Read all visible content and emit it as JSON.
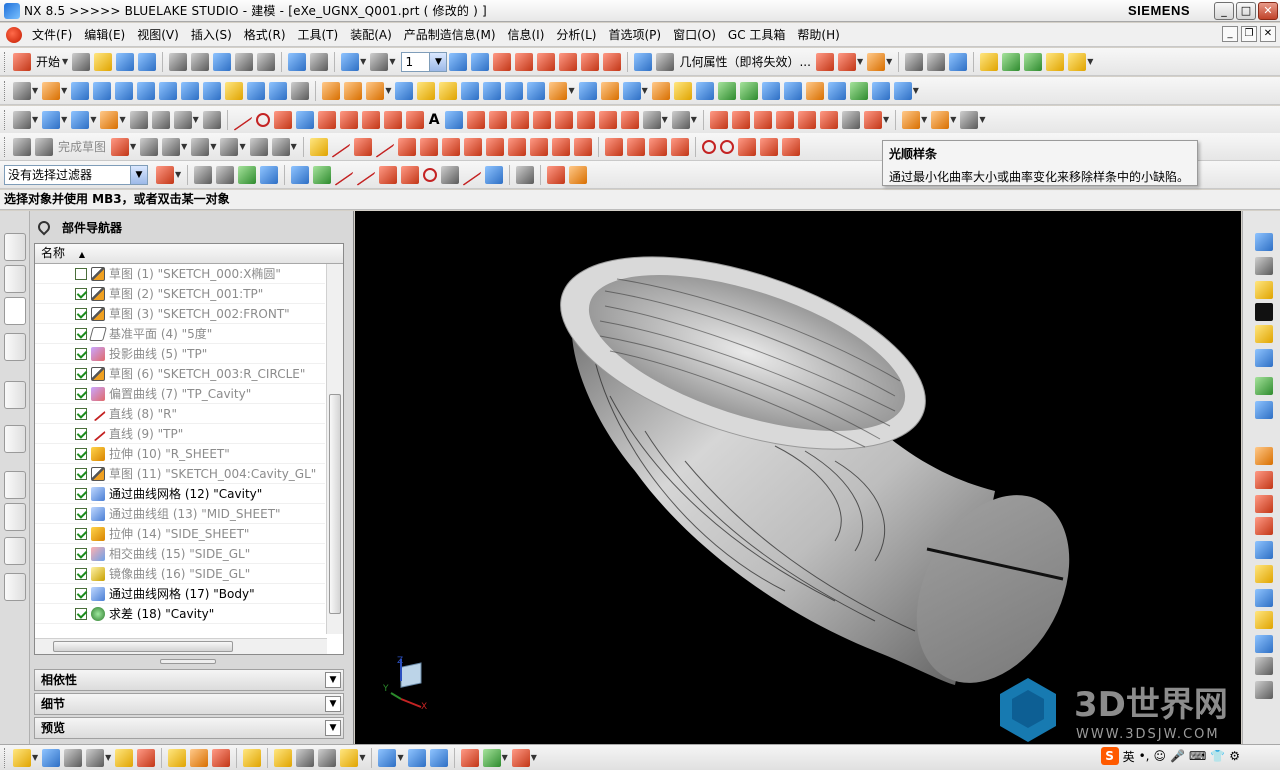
{
  "window": {
    "title": "NX 8.5  >>>>>  BLUELAKE STUDIO - 建模 - [eXe_UGNX_Q001.prt  ( 修改的 ) ]",
    "brand": "SIEMENS",
    "controls": {
      "minimize": "_",
      "maximize": "□",
      "close": "✕"
    }
  },
  "menubar": {
    "items": [
      "文件(F)",
      "编辑(E)",
      "视图(V)",
      "插入(S)",
      "格式(R)",
      "工具(T)",
      "装配(A)",
      "产品制造信息(M)",
      "信息(I)",
      "分析(L)",
      "首选项(P)",
      "窗口(O)",
      "GC 工具箱",
      "帮助(H)"
    ],
    "mdi": {
      "minimize": "_",
      "restore": "❐",
      "close": "✕"
    }
  },
  "toolbar": {
    "start_label": "开始",
    "layer_value": "1",
    "geometry_props_label": "几何属性（即将失效）...",
    "finish_sketch_label": "完成草图",
    "filter_value": "没有选择过滤器"
  },
  "prompt": {
    "text": "选择对象并使用 MB3，或者双击某一对象"
  },
  "tooltip": {
    "title": "光顺样条",
    "text": "通过最小化曲率大小或曲率变化来移除样条中的小缺陷。"
  },
  "navigator": {
    "title": "部件导航器",
    "column_name": "名称",
    "nodes": [
      {
        "label": "草图 (1) \"SKETCH_000:X椭圆\"",
        "checked": false,
        "dim": true,
        "icon": "sketch-icon"
      },
      {
        "label": "草图 (2) \"SKETCH_001:TP\"",
        "checked": true,
        "dim": true,
        "icon": "sketch-icon"
      },
      {
        "label": "草图 (3) \"SKETCH_002:FRONT\"",
        "checked": true,
        "dim": true,
        "icon": "sketch-icon"
      },
      {
        "label": "基准平面 (4) \"5度\"",
        "checked": true,
        "dim": true,
        "icon": "datum-plane-icon"
      },
      {
        "label": "投影曲线 (5) \"TP\"",
        "checked": true,
        "dim": true,
        "icon": "projected-curve-icon"
      },
      {
        "label": "草图 (6) \"SKETCH_003:R_CIRCLE\"",
        "checked": true,
        "dim": true,
        "icon": "sketch-icon"
      },
      {
        "label": "偏置曲线 (7) \"TP_Cavity\"",
        "checked": true,
        "dim": true,
        "icon": "offset-curve-icon"
      },
      {
        "label": "直线 (8) \"R\"",
        "checked": true,
        "dim": true,
        "icon": "line-icon"
      },
      {
        "label": "直线 (9) \"TP\"",
        "checked": true,
        "dim": true,
        "icon": "line-icon"
      },
      {
        "label": "拉伸 (10) \"R_SHEET\"",
        "checked": true,
        "dim": true,
        "icon": "extrude-icon"
      },
      {
        "label": "草图 (11) \"SKETCH_004:Cavity_GL\"",
        "checked": true,
        "dim": true,
        "icon": "sketch-icon"
      },
      {
        "label": "通过曲线网格 (12) \"Cavity\"",
        "checked": true,
        "dim": false,
        "icon": "curve-mesh-icon"
      },
      {
        "label": "通过曲线组 (13) \"MID_SHEET\"",
        "checked": true,
        "dim": true,
        "icon": "curve-mesh-icon"
      },
      {
        "label": "拉伸 (14) \"SIDE_SHEET\"",
        "checked": true,
        "dim": true,
        "icon": "extrude-icon"
      },
      {
        "label": "相交曲线 (15) \"SIDE_GL\"",
        "checked": true,
        "dim": true,
        "icon": "intersect-curve-icon"
      },
      {
        "label": "镜像曲线 (16) \"SIDE_GL\"",
        "checked": true,
        "dim": true,
        "icon": "mirror-curve-icon"
      },
      {
        "label": "通过曲线网格 (17) \"Body\"",
        "checked": true,
        "dim": false,
        "icon": "curve-mesh-icon"
      },
      {
        "label": "求差 (18) \"Cavity\"",
        "checked": true,
        "dim": false,
        "icon": "subtract-icon"
      }
    ],
    "sections": [
      "相依性",
      "细节",
      "预览"
    ]
  },
  "viewport": {
    "triad": {
      "x": "X",
      "y": "Y",
      "z": "Z"
    },
    "watermark": {
      "brand": "3D世界网",
      "url": "WWW.3DSJW.COM"
    }
  },
  "statusbar": {
    "ime_label": "英"
  },
  "colors": {
    "viewport_bg": "#000000",
    "accent_red": "#c42323",
    "check_green": "#1b8d1b"
  }
}
